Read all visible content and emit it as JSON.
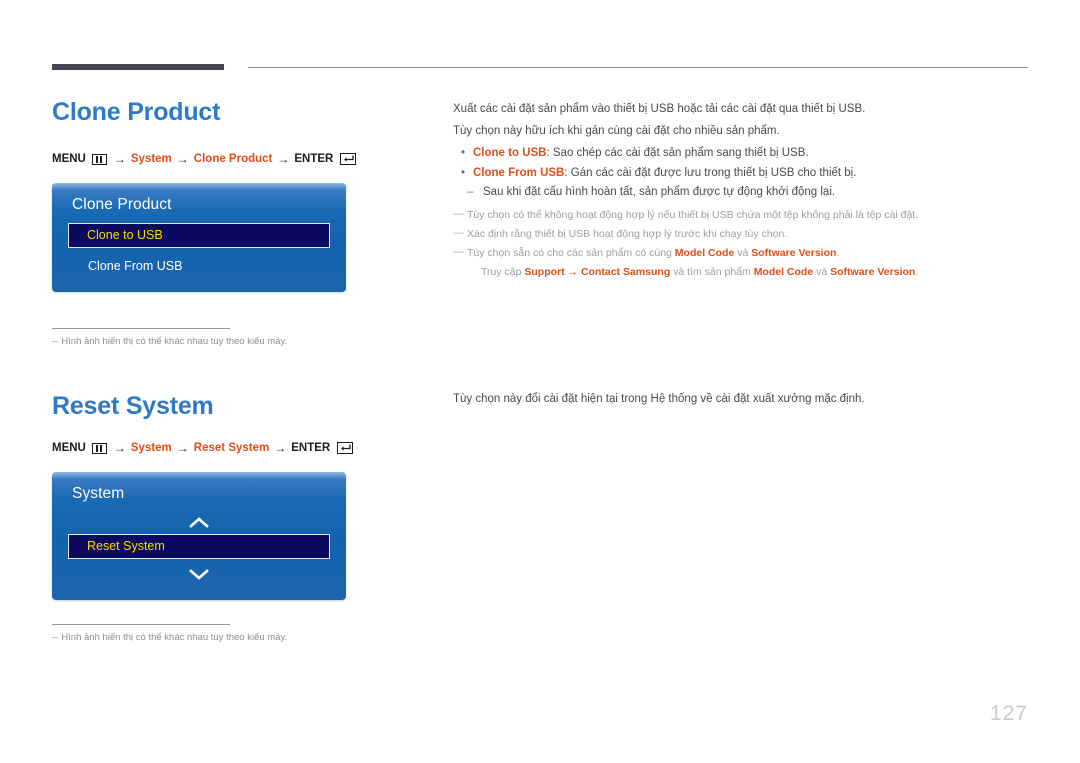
{
  "page": {
    "number": "127"
  },
  "icons": {
    "menu": "menu-icon",
    "enter": "enter-icon",
    "chevron_up": "chevron-up-icon",
    "chevron_down": "chevron-down-icon"
  },
  "colors": {
    "heading": "#2e7ac4",
    "accent": "#e04d18",
    "panel_blue": "#1463ae",
    "selected_fill": "#0b0a5e",
    "selected_text": "#ffd800",
    "note_gray": "#9d9d9d",
    "page_number": "#c9c9cf"
  },
  "sections": [
    {
      "id": "clone-product",
      "heading": "Clone Product",
      "menu_path": {
        "prefix": "MENU",
        "step1": "System",
        "step2": "Clone Product",
        "suffix": "ENTER",
        "arrow": "→"
      },
      "osd": {
        "title": "Clone Product",
        "rows": [
          {
            "label": "Clone to USB",
            "selected": true
          },
          {
            "label": "Clone From USB",
            "selected": false
          }
        ],
        "has_chevrons": false
      },
      "footnote": {
        "dash": "–",
        "text": "Hình ảnh hiển thị có thể khác nhau tùy theo kiểu máy."
      },
      "body": {
        "paragraphs": [
          "Xuất các cài đặt sản phẩm vào thiết bị USB hoặc tải các cài đặt qua thiết bị USB.",
          "Tùy chọn này hữu ích khi gán cùng cài đặt cho nhiều sản phẩm."
        ],
        "bullets": [
          {
            "dot": "•",
            "term": "Clone to USB",
            "rest": ": Sao chép các cài đặt sản phẩm sang thiết bị USB."
          },
          {
            "dot": "•",
            "term": "Clone From USB",
            "rest": ": Gán các cài đặt được lưu trong thiết bị USB cho thiết bị."
          }
        ],
        "subnote": {
          "dash": "–",
          "text": "Sau khi đặt cấu hình hoàn tất, sản phẩm được tự động khởi động lại."
        },
        "notes": [
          {
            "dash": "—",
            "text": "Tùy chọn có thể không hoạt động hợp lý nếu thiết bị USB chứa một tệp không phải là tệp cài đặt."
          },
          {
            "dash": "—",
            "text": "Xác định rằng thiết bị USB hoạt động hợp lý trước khi chạy tùy chọn."
          }
        ],
        "model_note": {
          "dash": "—",
          "line1_pre": "Tùy chọn sẵn có cho các sản phẩm có cùng ",
          "line1_term1": "Model Code",
          "line1_mid": " và ",
          "line1_term2": "Software Version",
          "line1_post": ".",
          "line2_pre": "Truy cập ",
          "line2_term1": "Support",
          "line2_arrow": " → ",
          "line2_term2": "Contact Samsung",
          "line2_mid": " và tìm sản phẩm ",
          "line2_term3": "Model Code",
          "line2_mid2": " và ",
          "line2_term4": "Software Version",
          "line2_post": "."
        }
      }
    },
    {
      "id": "reset-system",
      "heading": "Reset System",
      "menu_path": {
        "prefix": "MENU",
        "step1": "System",
        "step2": "Reset System",
        "suffix": "ENTER",
        "arrow": "→"
      },
      "osd": {
        "title": "System",
        "rows": [
          {
            "label": "Reset System",
            "selected": true
          }
        ],
        "has_chevrons": true
      },
      "footnote": {
        "dash": "–",
        "text": "Hình ảnh hiển thị có thể khác nhau tùy theo kiểu máy."
      },
      "body": {
        "paragraphs": [
          "Tùy chọn này đổi cài đặt hiện tại trong Hệ thống về cài đặt xuất xưởng mặc định."
        ]
      }
    }
  ]
}
